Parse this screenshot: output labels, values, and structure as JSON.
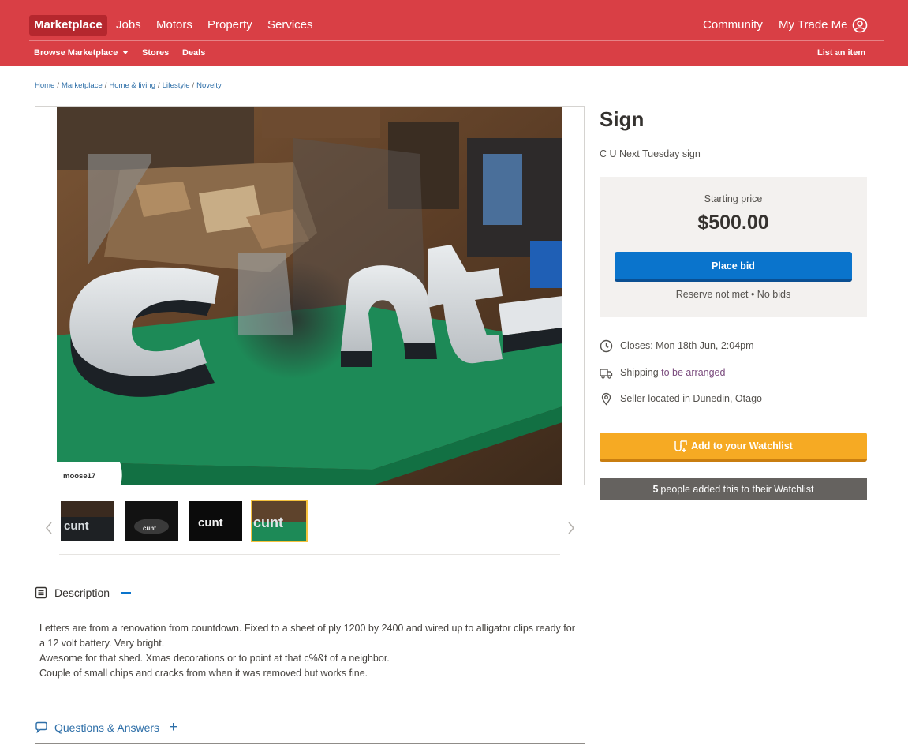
{
  "header": {
    "top_nav": [
      "Marketplace",
      "Jobs",
      "Motors",
      "Property",
      "Services"
    ],
    "right_nav": [
      "Community",
      "My Trade Me"
    ],
    "sub_nav": {
      "browse": "Browse Marketplace",
      "stores": "Stores",
      "deals": "Deals",
      "list": "List an item"
    }
  },
  "breadcrumb": [
    "Home",
    "Marketplace",
    "Home & living",
    "Lifestyle",
    "Novelty"
  ],
  "listing": {
    "title": "Sign",
    "subtitle": "C U Next Tuesday sign",
    "photo_watermark": "moose17",
    "sign_text": "cunt",
    "thumbnails": [
      "cunt",
      "cunt",
      "cunt",
      "cunt"
    ],
    "thumbnail_selected": 4
  },
  "pricing": {
    "label": "Starting price",
    "value": "$500.00",
    "bid_button": "Place bid",
    "reserve": "Reserve not met • No bids"
  },
  "details": {
    "closes": "Closes: Mon 18th Jun, 2:04pm",
    "shipping_prefix": "Shipping",
    "shipping_link": "to be arranged",
    "location": "Seller located in Dunedin, Otago"
  },
  "watchlist": {
    "button": "Add to your Watchlist",
    "count": "5",
    "count_text": "people added this to their Watchlist"
  },
  "description": {
    "heading": "Description",
    "lines": [
      "Letters are from a renovation from countdown.  Fixed to a sheet of ply 1200 by 2400 and wired up to alligator clips ready for a 12 volt battery. Very bright.",
      "Awesome for that shed. Xmas decorations or to point at that c%&t of a neighbor.",
      "Couple of small chips and cracks from when it was removed but works fine."
    ]
  },
  "qa": {
    "heading": "Questions & Answers"
  },
  "colors": {
    "brand": "#d93f45",
    "bid": "#0a74cc",
    "watch": "#f6aa23",
    "link": "#2e6fa8"
  }
}
